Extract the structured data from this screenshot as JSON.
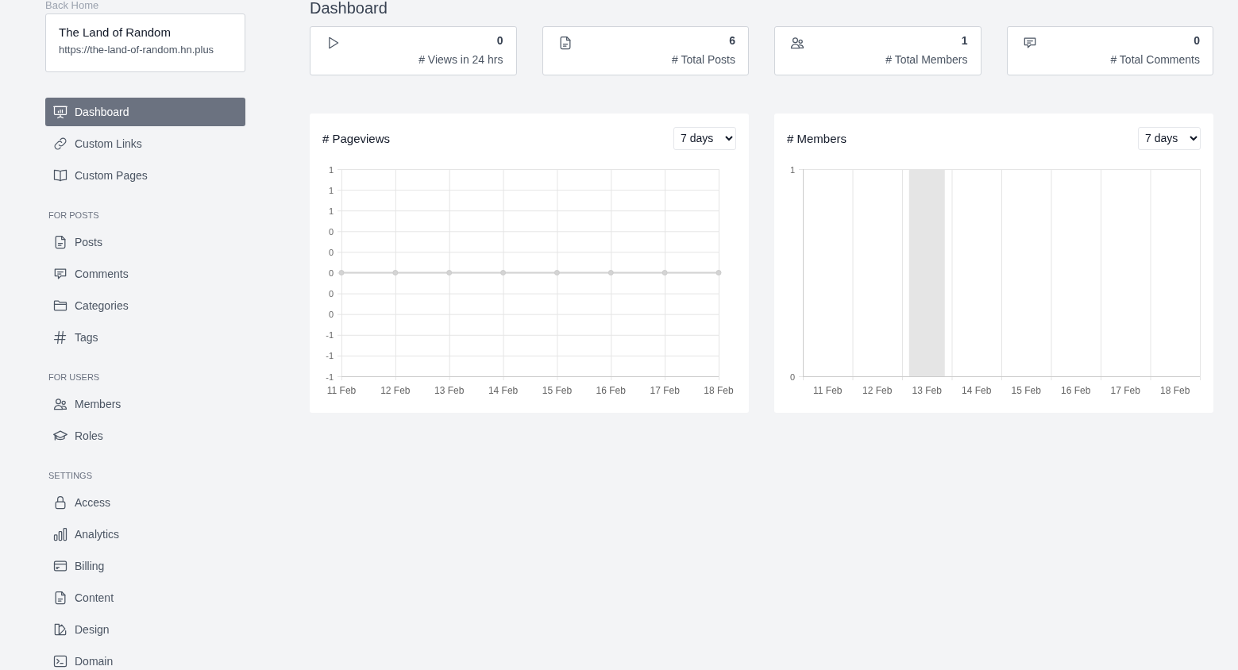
{
  "back_link": "Back Home",
  "site": {
    "name": "The Land of Random",
    "url": "https://the-land-of-random.hn.plus"
  },
  "sidebar": {
    "sections": [
      {
        "items": [
          {
            "label": "Dashboard",
            "selected": true
          },
          {
            "label": "Custom Links",
            "selected": false
          },
          {
            "label": "Custom Pages",
            "selected": false
          }
        ]
      },
      {
        "heading": "FOR POSTS",
        "items": [
          {
            "label": "Posts",
            "selected": false
          },
          {
            "label": "Comments",
            "selected": false
          },
          {
            "label": "Categories",
            "selected": false
          },
          {
            "label": "Tags",
            "selected": false
          }
        ]
      },
      {
        "heading": "FOR USERS",
        "items": [
          {
            "label": "Members",
            "selected": false
          },
          {
            "label": "Roles",
            "selected": false
          }
        ]
      },
      {
        "heading": "SETTINGS",
        "items": [
          {
            "label": "Access",
            "selected": false
          },
          {
            "label": "Analytics",
            "selected": false
          },
          {
            "label": "Billing",
            "selected": false
          },
          {
            "label": "Content",
            "selected": false
          },
          {
            "label": "Design",
            "selected": false
          },
          {
            "label": "Domain",
            "selected": false
          }
        ]
      }
    ]
  },
  "page_title": "Dashboard",
  "stats": [
    {
      "value": "0",
      "label": "# Views in 24 hrs"
    },
    {
      "value": "6",
      "label": "# Total Posts"
    },
    {
      "value": "1",
      "label": "# Total Members"
    },
    {
      "value": "0",
      "label": "# Total Comments"
    }
  ],
  "charts": [
    {
      "title": "# Pageviews",
      "range": "7 days",
      "chart_data": {
        "type": "line",
        "categories": [
          "11 Feb",
          "12 Feb",
          "13 Feb",
          "14 Feb",
          "15 Feb",
          "16 Feb",
          "17 Feb",
          "18 Feb"
        ],
        "grid": true,
        "series": [
          {
            "color": "#d4d4d4",
            "marker": "circle",
            "values": [
              0,
              0,
              0,
              0,
              0,
              0,
              0,
              0
            ]
          }
        ],
        "ylim": [
          -1,
          1
        ],
        "yticks": [
          {
            "value": 1,
            "label": "1"
          },
          {
            "value": 0.8,
            "label": "1"
          },
          {
            "value": 0.6,
            "label": "1"
          },
          {
            "value": 0.4,
            "label": "0"
          },
          {
            "value": 0.2,
            "label": "0"
          },
          {
            "value": 0,
            "label": "0"
          },
          {
            "value": -0.2,
            "label": "0"
          },
          {
            "value": -0.4,
            "label": "0"
          },
          {
            "value": -0.6,
            "label": "-1"
          },
          {
            "value": -0.8,
            "label": "-1"
          },
          {
            "value": -1,
            "label": "-1"
          }
        ]
      }
    },
    {
      "title": "# Members",
      "range": "7 days",
      "chart_data": {
        "type": "bar",
        "categories": [
          "11 Feb",
          "12 Feb",
          "13 Feb",
          "14 Feb",
          "15 Feb",
          "16 Feb",
          "17 Feb",
          "18 Feb"
        ],
        "grid": true,
        "series": [
          {
            "color": "#e5e5e5",
            "values": [
              0,
              0,
              1,
              0,
              0,
              0,
              0,
              0
            ]
          }
        ],
        "ylim": [
          0,
          1
        ],
        "yticks": [
          0,
          1
        ]
      }
    }
  ]
}
